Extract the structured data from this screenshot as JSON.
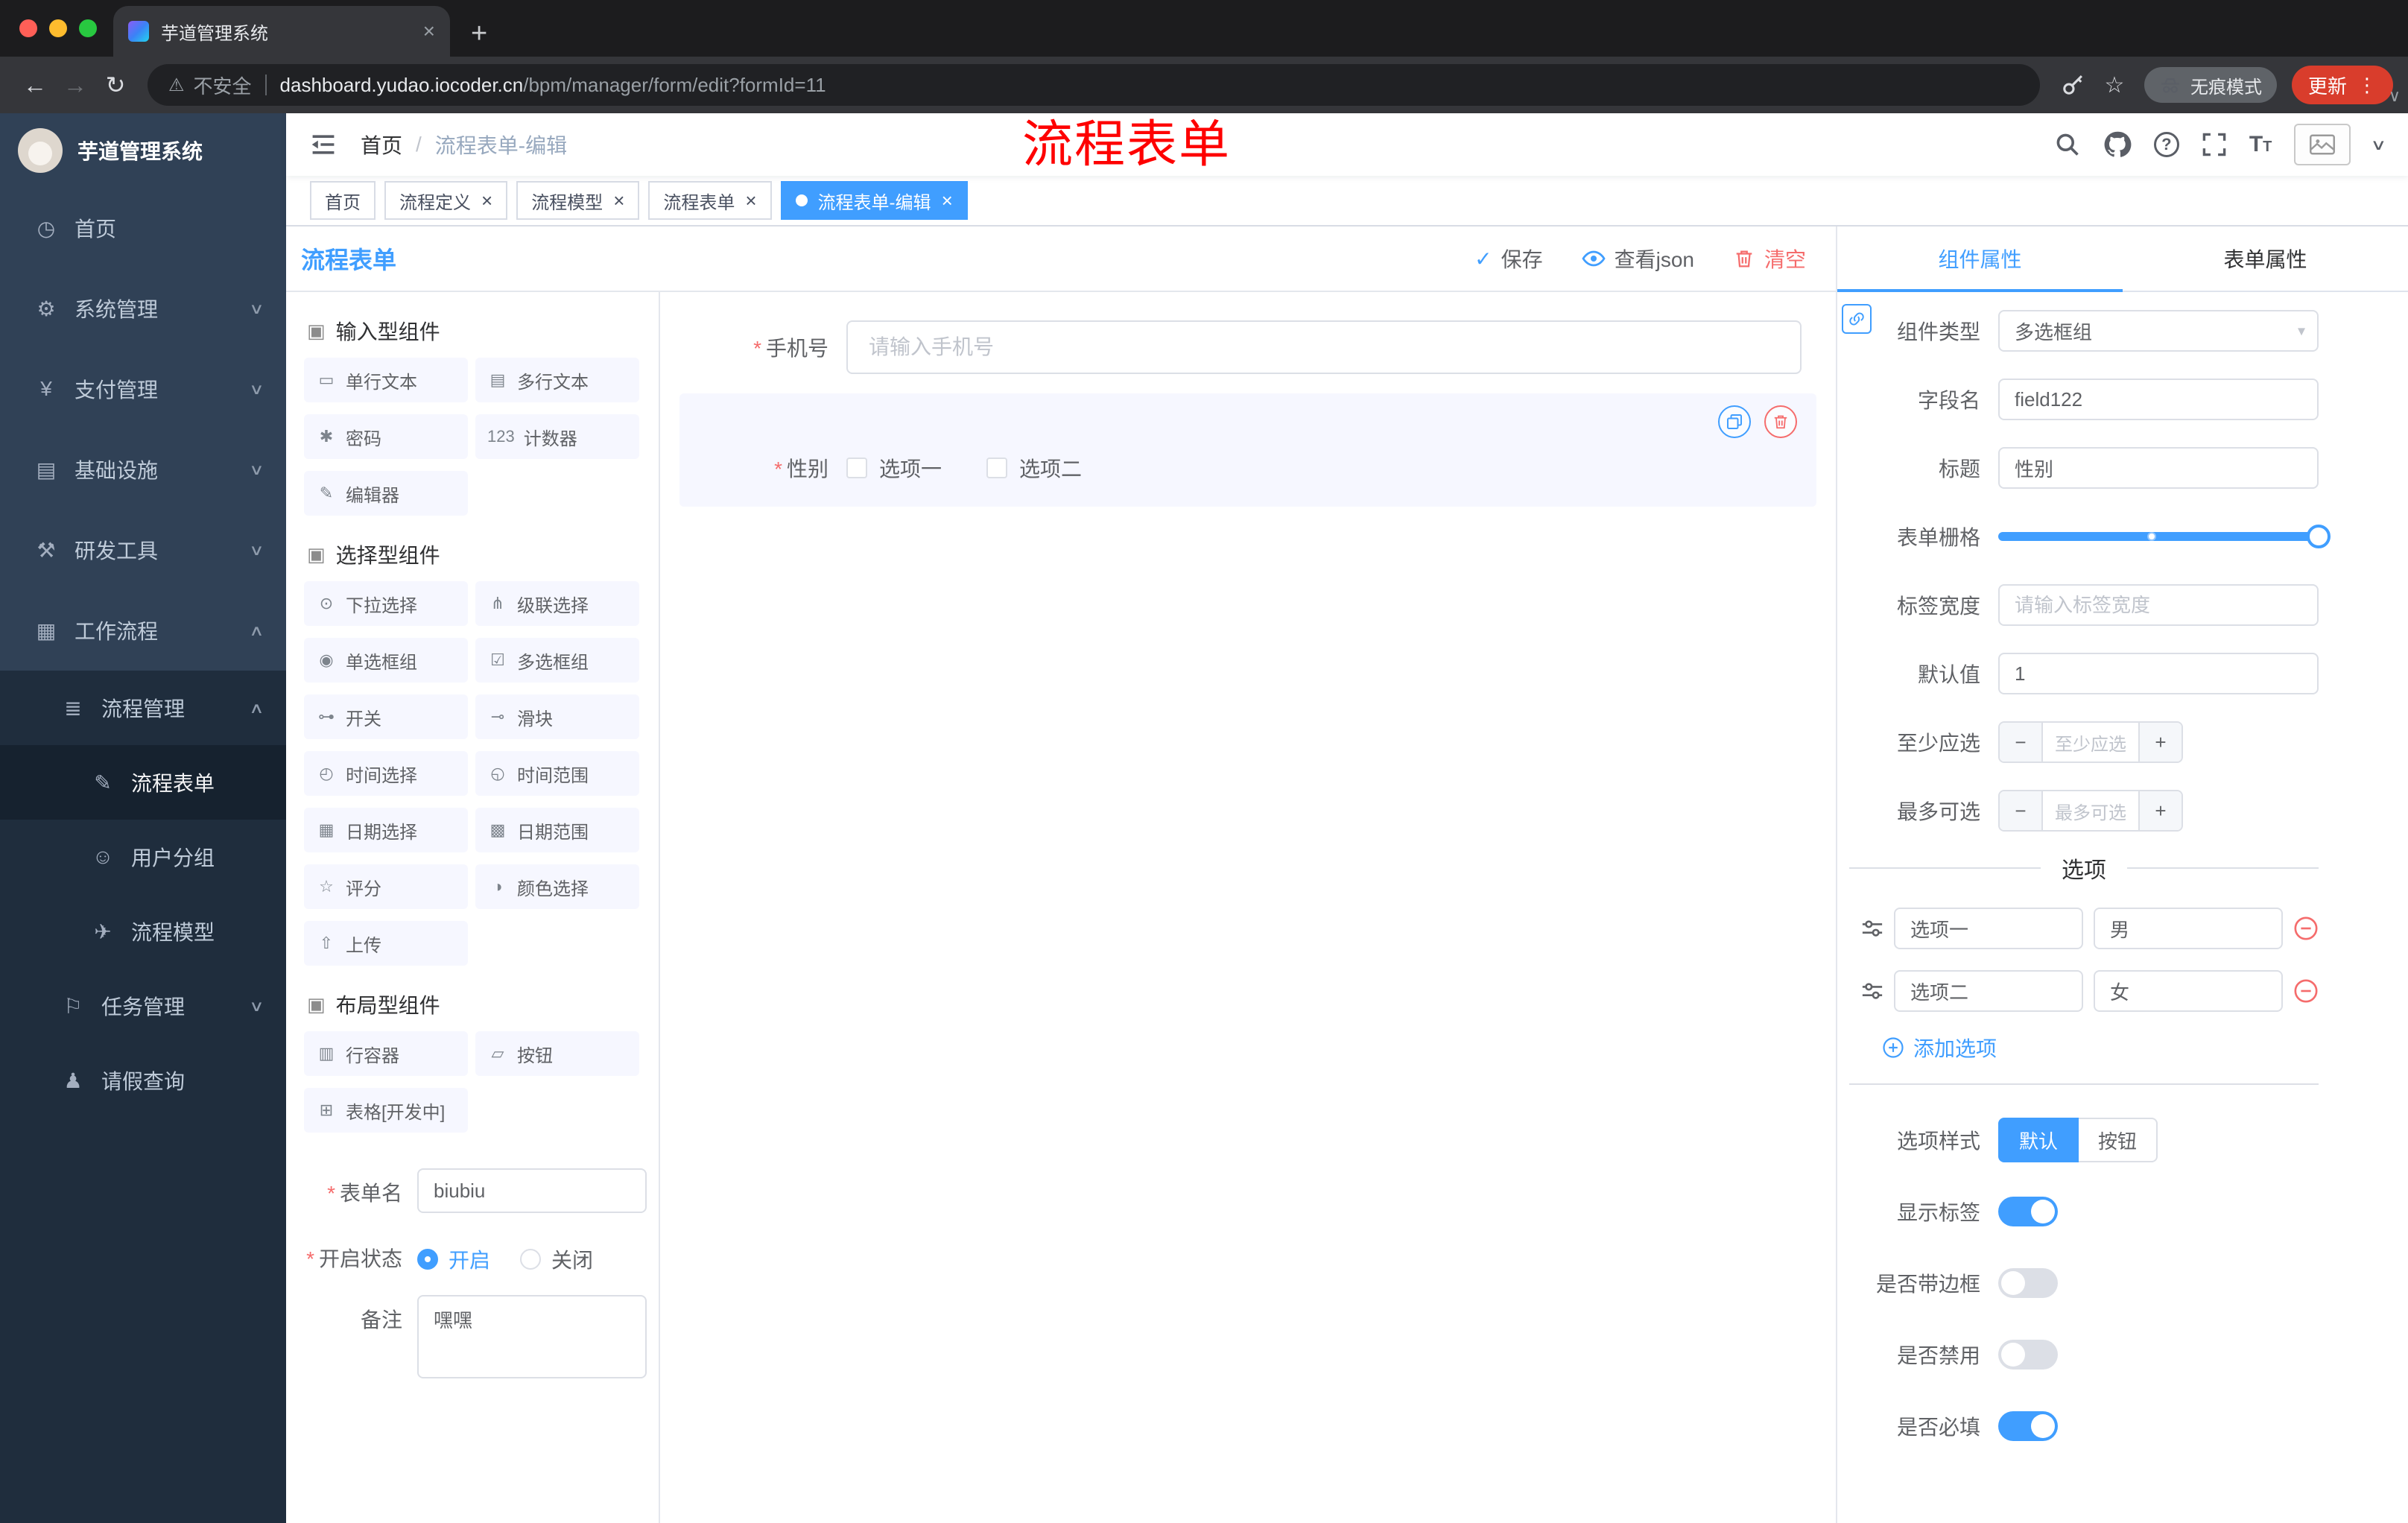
{
  "ui": {
    "asterisk": "*",
    "close": "×",
    "plus": "+",
    "minus": "−",
    "check": "✓",
    "more": "⋮",
    "question": "?",
    "caret_down": "▾",
    "chevron_up": "∧",
    "chevron_down": "∨",
    "back": "←",
    "forward": "→",
    "reload": "↻",
    "warning": "⚠",
    "star": "☆",
    "group_glyph": "▣",
    "font_icon_big": "T",
    "font_icon_small": "T"
  },
  "colors": {
    "primary": "#409eff",
    "danger": "#f56c6c",
    "annotation": "#ff0000",
    "sidebar": "#304156"
  },
  "browser": {
    "tab": {
      "title": "芋道管理系统"
    },
    "omnibox": {
      "security_label": "不安全",
      "url_host": "dashboard.yudao.iocoder.cn",
      "url_path": "/bpm/manager/form/edit?formId=11"
    },
    "incognito_label": "无痕模式",
    "update_label": "更新"
  },
  "sidebar": {
    "logo_title": "芋道管理系统",
    "menu": [
      {
        "id": "home",
        "label": "首页",
        "icon": "dashboard-icon",
        "glyph": "◷",
        "level": 1
      },
      {
        "id": "system",
        "label": "系统管理",
        "icon": "gear-icon",
        "glyph": "⚙",
        "level": 1,
        "chevron": "down"
      },
      {
        "id": "payment",
        "label": "支付管理",
        "icon": "yen-icon",
        "glyph": "¥",
        "level": 1,
        "chevron": "down"
      },
      {
        "id": "infrastructure",
        "label": "基础设施",
        "icon": "server-icon",
        "glyph": "▤",
        "level": 1,
        "chevron": "down"
      },
      {
        "id": "devtools",
        "label": "研发工具",
        "icon": "hammer-icon",
        "glyph": "⚒",
        "level": 1,
        "chevron": "down"
      },
      {
        "id": "workflow",
        "label": "工作流程",
        "icon": "briefcase-icon",
        "glyph": "▦",
        "level": 1,
        "chevron": "up"
      },
      {
        "id": "process-manage",
        "label": "流程管理",
        "icon": "list-icon",
        "glyph": "≣",
        "level": 2,
        "chevron": "up"
      },
      {
        "id": "process-form",
        "label": "流程表单",
        "icon": "form-icon",
        "glyph": "✎",
        "level": 3,
        "active": true
      },
      {
        "id": "user-group",
        "label": "用户分组",
        "icon": "users-icon",
        "glyph": "☺",
        "level": 3
      },
      {
        "id": "process-model",
        "label": "流程模型",
        "icon": "send-icon",
        "glyph": "✈",
        "level": 3
      },
      {
        "id": "task-manage",
        "label": "任务管理",
        "icon": "flag-icon",
        "glyph": "⚐",
        "level": 2,
        "chevron": "down"
      },
      {
        "id": "leave-query",
        "label": "请假查询",
        "icon": "person-icon",
        "glyph": "♟",
        "level": 2
      }
    ]
  },
  "header": {
    "breadcrumb": {
      "home": "首页",
      "separator": "/",
      "current": "流程表单-编辑"
    },
    "annotation": "流程表单"
  },
  "tags": [
    {
      "id": "home",
      "label": "首页",
      "closable": false,
      "active": false
    },
    {
      "id": "process-definition",
      "label": "流程定义",
      "closable": true,
      "active": false
    },
    {
      "id": "process-model",
      "label": "流程模型",
      "closable": true,
      "active": false
    },
    {
      "id": "process-form",
      "label": "流程表单",
      "closable": true,
      "active": false
    },
    {
      "id": "process-form-edit",
      "label": "流程表单-编辑",
      "closable": true,
      "active": true
    }
  ],
  "designer": {
    "title": "流程表单",
    "toolbar": {
      "save": "保存",
      "view_json": "查看json",
      "clear": "清空"
    },
    "groups": [
      {
        "title": "输入型组件",
        "items": [
          {
            "id": "single-line-text",
            "label": "单行文本",
            "icon": "text-field-icon",
            "glyph": "▭"
          },
          {
            "id": "multi-line-text",
            "label": "多行文本",
            "icon": "textarea-icon",
            "glyph": "▤"
          },
          {
            "id": "password",
            "label": "密码",
            "icon": "lock-icon",
            "glyph": "✱"
          },
          {
            "id": "counter",
            "label": "计数器",
            "icon": "counter-icon",
            "glyph": "123"
          },
          {
            "id": "editor",
            "label": "编辑器",
            "icon": "edit-icon",
            "glyph": "✎"
          }
        ]
      },
      {
        "title": "选择型组件",
        "items": [
          {
            "id": "select",
            "label": "下拉选择",
            "icon": "select-icon",
            "glyph": "⊙"
          },
          {
            "id": "cascader",
            "label": "级联选择",
            "icon": "cascader-icon",
            "glyph": "⋔"
          },
          {
            "id": "radio-group",
            "label": "单选框组",
            "icon": "radio-icon",
            "glyph": "◉"
          },
          {
            "id": "checkbox-group",
            "label": "多选框组",
            "icon": "checkbox-icon",
            "glyph": "☑"
          },
          {
            "id": "switch",
            "label": "开关",
            "icon": "switch-icon",
            "glyph": "⊶"
          },
          {
            "id": "slider",
            "label": "滑块",
            "icon": "slider-icon",
            "glyph": "⊸"
          },
          {
            "id": "time-picker",
            "label": "时间选择",
            "icon": "clock-icon",
            "glyph": "◴"
          },
          {
            "id": "time-range",
            "label": "时间范围",
            "icon": "clock-range-icon",
            "glyph": "◵"
          },
          {
            "id": "date-picker",
            "label": "日期选择",
            "icon": "calendar-icon",
            "glyph": "▦"
          },
          {
            "id": "date-range",
            "label": "日期范围",
            "icon": "calendar-range-icon",
            "glyph": "▩"
          },
          {
            "id": "rate",
            "label": "评分",
            "icon": "star-icon",
            "glyph": "☆"
          },
          {
            "id": "color-picker",
            "label": "颜色选择",
            "icon": "color-icon",
            "glyph": "◑"
          },
          {
            "id": "upload",
            "label": "上传",
            "icon": "upload-icon",
            "glyph": "⇧"
          }
        ]
      },
      {
        "title": "布局型组件",
        "items": [
          {
            "id": "row-container",
            "label": "行容器",
            "icon": "row-icon",
            "glyph": "▥"
          },
          {
            "id": "button",
            "label": "按钮",
            "icon": "button-icon",
            "glyph": "▱"
          },
          {
            "id": "table",
            "label": "表格[开发中]",
            "icon": "table-icon",
            "glyph": "⊞"
          }
        ]
      }
    ],
    "meta": {
      "name": {
        "label": "表单名",
        "value": "biubiu",
        "required": true
      },
      "status": {
        "label": "开启状态",
        "required": true,
        "options": [
          {
            "label": "开启",
            "selected": true
          },
          {
            "label": "关闭",
            "selected": false
          }
        ]
      },
      "remark": {
        "label": "备注",
        "value": "嘿嘿"
      }
    }
  },
  "can": {
    "phone_field": {
      "label": "手机号",
      "required": true,
      "placeholder": "请输入手机号"
    },
    "gender_field": {
      "label": "性别",
      "required": true,
      "options": [
        "选项一",
        "选项二"
      ]
    }
  },
  "properties": {
    "tabs": {
      "component": "组件属性",
      "form": "表单属性"
    },
    "component_type": {
      "label": "组件类型",
      "value": "多选框组"
    },
    "field_name": {
      "label": "字段名",
      "value": "field122"
    },
    "title": {
      "label": "标题",
      "value": "性别"
    },
    "grid": {
      "label": "表单栅格"
    },
    "label_width": {
      "label": "标签宽度",
      "placeholder": "请输入标签宽度"
    },
    "default_value": {
      "label": "默认值",
      "value": "1"
    },
    "min_select": {
      "label": "至少应选",
      "placeholder": "至少应选"
    },
    "max_select": {
      "label": "最多可选",
      "placeholder": "最多可选"
    },
    "options_divider": "选项",
    "options": [
      {
        "name": "选项一",
        "value": "男"
      },
      {
        "name": "选项二",
        "value": "女"
      }
    ],
    "add_option": "添加选项",
    "option_style": {
      "label": "选项样式",
      "options": [
        "默认",
        "按钮"
      ],
      "selected": "默认"
    },
    "switches": [
      {
        "id": "show-label",
        "label": "显示标签",
        "on": true
      },
      {
        "id": "bordered",
        "label": "是否带边框",
        "on": false
      },
      {
        "id": "disabled",
        "label": "是否禁用",
        "on": false
      },
      {
        "id": "required",
        "label": "是否必填",
        "on": true
      }
    ]
  }
}
